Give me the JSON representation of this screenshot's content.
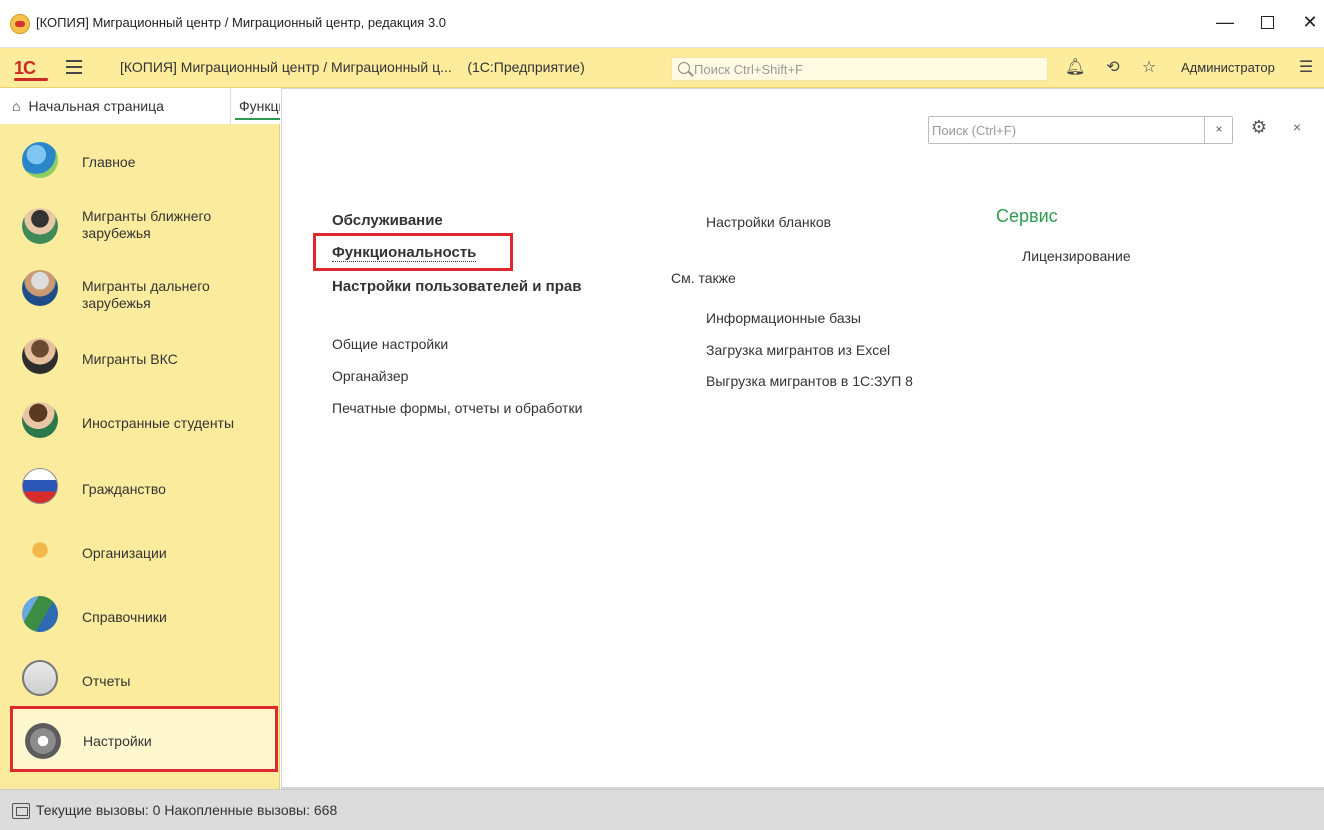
{
  "window": {
    "title": "[КОПИЯ] Миграционный центр / Миграционный центр, редакция 3.0"
  },
  "toolbar": {
    "logo": "1С",
    "app_title": "[КОПИЯ] Миграционный центр / Миграционный ц...",
    "platform": "(1С:Предприятие)",
    "search_placeholder": "Поиск Ctrl+Shift+F",
    "user": "Администратор"
  },
  "tabs": {
    "home": "Начальная страница",
    "current": "Функциональность"
  },
  "sidebar": {
    "items": [
      {
        "label": "Главное",
        "icon": "people-icon"
      },
      {
        "label": "Мигранты ближнего зарубежья",
        "icon": "migrant-near-icon"
      },
      {
        "label": "Мигранты дальнего зарубежья",
        "icon": "migrant-far-icon"
      },
      {
        "label": "Мигранты ВКС",
        "icon": "migrant-vks-icon"
      },
      {
        "label": "Иностранные студенты",
        "icon": "student-icon"
      },
      {
        "label": "Гражданство",
        "icon": "flag-icon"
      },
      {
        "label": "Организации",
        "icon": "organization-icon"
      },
      {
        "label": "Справочники",
        "icon": "books-icon"
      },
      {
        "label": "Отчеты",
        "icon": "report-icon"
      },
      {
        "label": "Настройки",
        "icon": "gear-icon"
      }
    ]
  },
  "panel": {
    "search_placeholder": "Поиск (Ctrl+F)",
    "clear": "×",
    "close": "×",
    "col1": {
      "service": "Обслуживание",
      "functionality": "Функциональность",
      "users_rights": "Настройки пользователей и прав",
      "general": "Общие настройки",
      "organizer": "Органайзер",
      "print_forms": "Печатные формы, отчеты и обработки"
    },
    "col2": {
      "blanks": "Настройки бланков",
      "see_also": "См. также",
      "info_bases": "Информационные базы",
      "load_excel": "Загрузка мигрантов из Excel",
      "unload_zup": "Выгрузка мигрантов в 1С:ЗУП 8"
    },
    "col3": {
      "service_head": "Сервис",
      "licensing": "Лицензирование"
    }
  },
  "status": {
    "text": "Текущие вызовы: 0   Накопленные вызовы: 668"
  }
}
